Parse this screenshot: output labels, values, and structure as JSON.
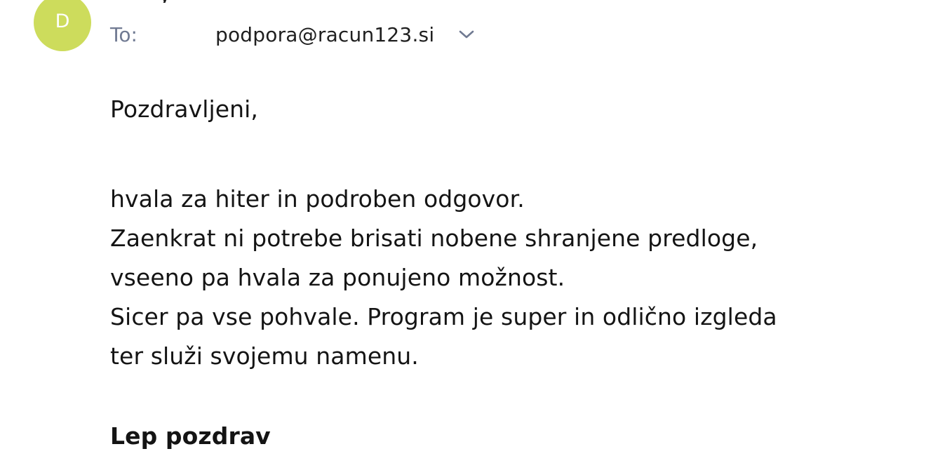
{
  "sender": {
    "avatar_letter": "D",
    "avatar_color": "#cddc5c"
  },
  "recipient": {
    "label": "To:",
    "address": "podpora@racun123.si",
    "expand_icon": "chevron-down-icon"
  },
  "message": {
    "greeting": "Pozdravljeni,",
    "lines": [
      "hvala za hiter in podroben odgovor.",
      "Zaenkrat ni potrebe brisati nobene shranjene predloge,",
      "vseeno pa hvala za ponujeno možnost.",
      "Sicer pa vse pohvale. Program je super in odlično izgleda",
      "ter služi svojemu namenu."
    ],
    "signature": "Lep pozdrav"
  }
}
